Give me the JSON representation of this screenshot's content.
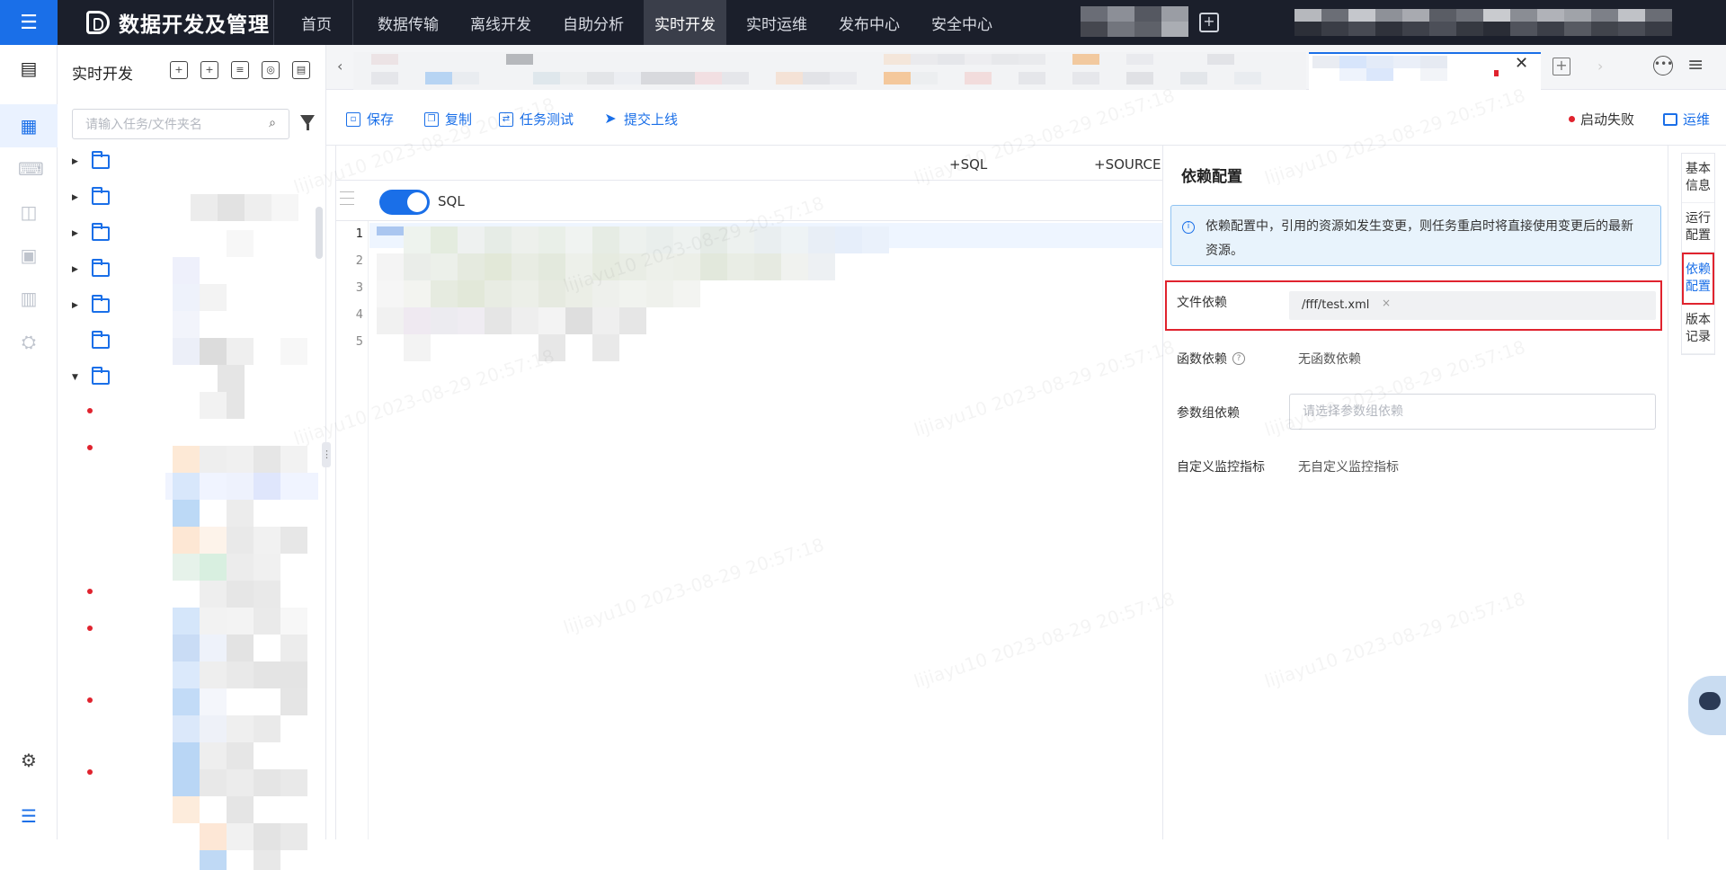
{
  "app": {
    "title": "数据开发及管理"
  },
  "nav": {
    "items": [
      {
        "label": "首页"
      },
      {
        "label": "数据传输"
      },
      {
        "label": "离线开发"
      },
      {
        "label": "自助分析"
      },
      {
        "label": "实时开发",
        "active": true
      },
      {
        "label": "实时运维"
      },
      {
        "label": "发布中心"
      },
      {
        "label": "安全中心"
      }
    ]
  },
  "tree": {
    "title": "实时开发",
    "search_placeholder": "请输入任务/文件夹名"
  },
  "toolbar": {
    "save": "保存",
    "copy": "复制",
    "test": "任务测试",
    "submit": "提交上线",
    "status": "启动失败",
    "ops": "运维"
  },
  "editor": {
    "add_sql": "+SQL",
    "add_source": "+SOURCE",
    "mode_label": "SQL",
    "line_numbers": [
      "1",
      "2",
      "3",
      "4",
      "5"
    ]
  },
  "dependency": {
    "title": "依赖配置",
    "notice": "依赖配置中，引用的资源如发生变更，则任务重启时将直接使用变更后的最新资源。",
    "file_dep_label": "文件依赖",
    "file_dep_value": "/fff/test.xml",
    "func_dep_label": "函数依赖",
    "func_dep_value": "无函数依赖",
    "param_dep_label": "参数组依赖",
    "param_dep_placeholder": "请选择参数组依赖",
    "monitor_label": "自定义监控指标",
    "monitor_value": "无自定义监控指标"
  },
  "right_tabs": [
    {
      "label": "基本信息"
    },
    {
      "label": "运行配置"
    },
    {
      "label": "依赖配置",
      "active": true
    },
    {
      "label": "版本记录"
    }
  ],
  "watermark": "lijiayu10 2023-08-29 20:57:18",
  "colors": {
    "accent": "#1a6fe8",
    "topbar": "#1b1f2b",
    "alert": "#e0232e"
  }
}
